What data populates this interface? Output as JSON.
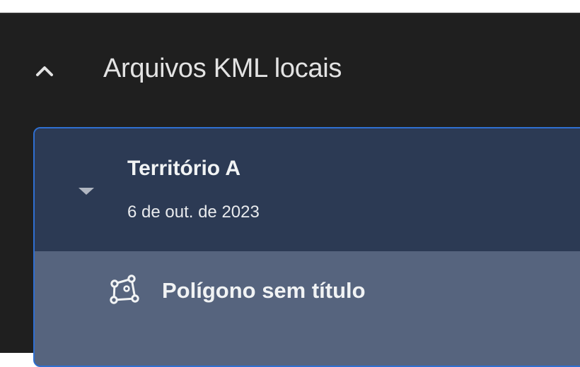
{
  "local_kml": {
    "section_title": "Arquivos KML locais",
    "expanded": true,
    "folder": {
      "name": "Território A",
      "date": "6 de out. de 2023",
      "expanded": true,
      "items": [
        {
          "icon": "polygon-icon",
          "label": "Polígono sem título"
        }
      ]
    }
  },
  "colors": {
    "panel_bg": "#1f1f1f",
    "folder_bg": "#2c3a54",
    "item_bg": "#56647e",
    "focus_border": "#2f6fd1",
    "text": "#e3e3e3"
  }
}
